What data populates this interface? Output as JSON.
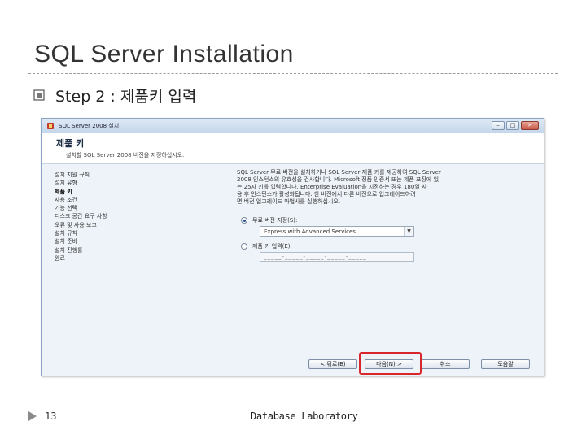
{
  "slide": {
    "title": "SQL Server Installation",
    "bullet": "Step 2 : 제품키 입력",
    "page_number": "13",
    "footer": "Database Laboratory"
  },
  "dialog": {
    "window_title": "SQL Server 2008 설치",
    "heading": "제품 키",
    "description": "설치할 SQL Server 2008 버전을 지정하십시오.",
    "nav_items": [
      {
        "label": "설치 지원 규칙",
        "active": false
      },
      {
        "label": "설치 유형",
        "active": false
      },
      {
        "label": "제품 키",
        "active": true
      },
      {
        "label": "사용 조건",
        "active": false
      },
      {
        "label": "기능 선택",
        "active": false
      },
      {
        "label": "디스크 공간 요구 사항",
        "active": false
      },
      {
        "label": "오류 및 사용 보고",
        "active": false
      },
      {
        "label": "설치 규칙",
        "active": false
      },
      {
        "label": "설치 준비",
        "active": false
      },
      {
        "label": "설치 진행률",
        "active": false
      },
      {
        "label": "완료",
        "active": false
      }
    ],
    "info_lines": [
      "SQL Server 무료 버전을 설치하거나 SQL Server 제품 키를 제공하여 SQL Server",
      "2008 인스턴스의 유효성을 검사합니다. Microsoft 정품 인증서 또는 제품 포장에 있",
      "는 25자 키를 입력합니다. Enterprise Evaluation을 지정하는 경우 180일 사",
      "용 후 인스턴스가 활성화됩니다. 한 버전에서 다른 버전으로 업그레이드하려",
      "면 버전 업그레이드 마법사를 실행하십시오."
    ],
    "free_edition_label": "무료 버전 지정(S):",
    "free_edition_value": "Express with Advanced Services",
    "product_key_label": "제품 키 입력(E):",
    "product_key_value": "_____-_____-_____-_____-_____",
    "buttons": {
      "back": "< 뒤로(B)",
      "next": "다음(N) >",
      "cancel": "취소",
      "help": "도움말"
    }
  },
  "colors": {
    "highlight": "#d8262a",
    "titlebar": "#c5d7ec"
  }
}
